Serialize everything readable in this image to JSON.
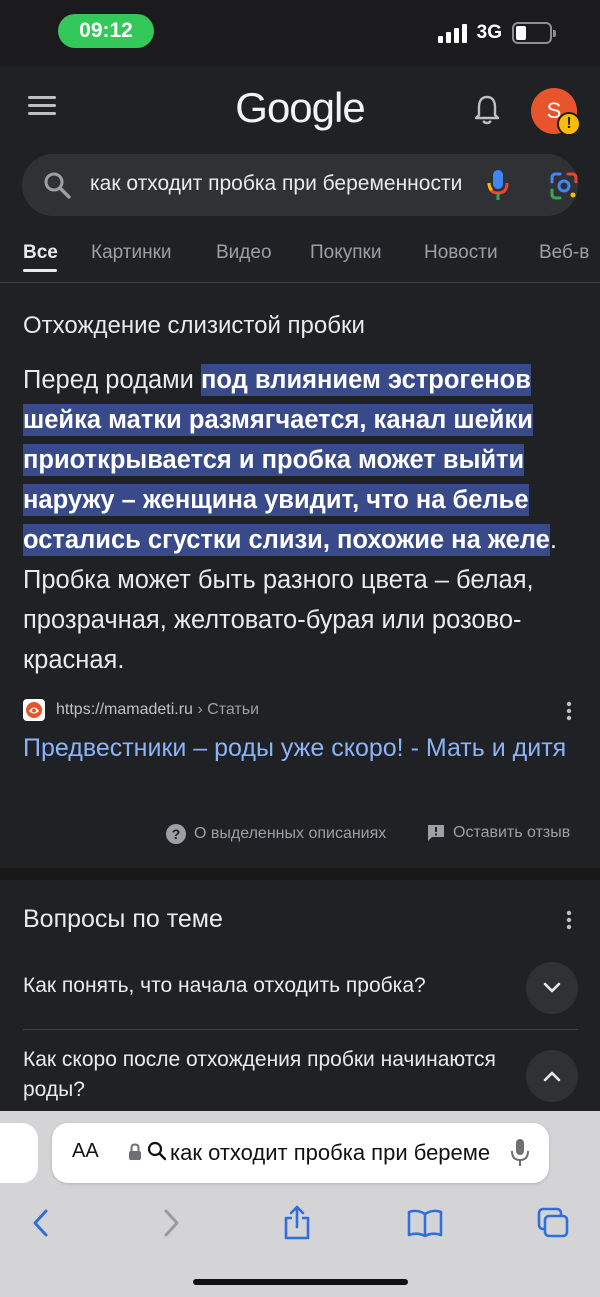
{
  "status_bar": {
    "time": "09:12",
    "network": "3G"
  },
  "header": {
    "logo": "Google",
    "avatar_letter": "S",
    "avatar_badge": "!"
  },
  "search": {
    "query": "как отходит пробка при беременности"
  },
  "tabs": [
    {
      "label": "Все",
      "active": true
    },
    {
      "label": "Картинки"
    },
    {
      "label": "Видео"
    },
    {
      "label": "Покупки"
    },
    {
      "label": "Новости"
    },
    {
      "label": "Веб-в"
    }
  ],
  "snippet": {
    "heading": "Отхождение слизистой пробки",
    "intro": "Перед родами ",
    "highlight": "под влиянием эстрогенов шейка матки размягчается, канал шейки приоткрывается и пробка может выйти наружу – женщина увидит, что на белье остались сгустки слизи, похожие на желе",
    "rest": ". Пробка может быть разного цвета – белая, прозрачная, желтовато-бурая или розово-красная.",
    "source_url": "https://mamadeti.ru",
    "source_path": " › Статьи",
    "link_title": "Предвестники – роды уже скоро! - Мать и дитя",
    "about_label": "О выделенных описаниях",
    "feedback_label": "Оставить отзыв"
  },
  "paa": {
    "title": "Вопросы по теме",
    "questions": [
      {
        "text": "Как понять, что начала отходить пробка?",
        "expanded": false
      },
      {
        "text": "Как скоро после отхождения пробки начинаются роды?",
        "expanded": true
      }
    ]
  },
  "safari": {
    "aa_label": "AA",
    "address_text": "как отходит пробка при беременности"
  },
  "colors": {
    "accent_link": "#8ab4f8",
    "highlight_bg": "#394a8b",
    "status_pill": "#34c759",
    "avatar": "#e8552c"
  }
}
